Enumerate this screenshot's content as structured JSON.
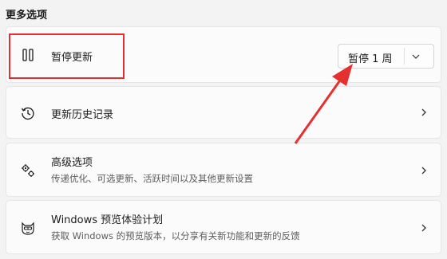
{
  "section_title": "更多选项",
  "pause_updates": {
    "title": "暂停更新",
    "button_label": "暂停 1 周"
  },
  "update_history": {
    "title": "更新历史记录"
  },
  "advanced_options": {
    "title": "高级选项",
    "subtitle": "传递优化、可选更新、活跃时间以及其他更新设置"
  },
  "insider": {
    "title": "Windows 预览体验计划",
    "subtitle": "获取 Windows 的预览版本，以分享有关新功能和更新的反馈"
  },
  "colors": {
    "highlight": "#e53030",
    "card_bg": "#fbfbfb",
    "page_bg": "#f3f3f3"
  },
  "icons": [
    "pause-icon",
    "history-icon",
    "gears-icon",
    "insider-cat-icon",
    "chevron-right-icon",
    "chevron-down-icon"
  ]
}
